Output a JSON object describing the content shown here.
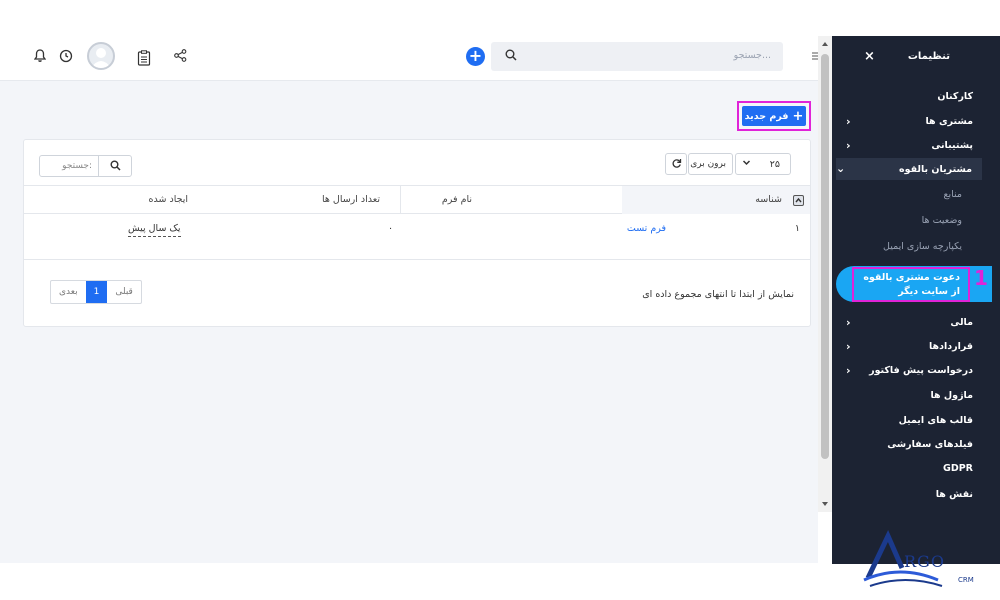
{
  "header": {
    "search_placeholder": "جستجو..."
  },
  "sidebar": {
    "title": "تنظیمات",
    "close": "×",
    "items": [
      {
        "label": "کارکنان"
      },
      {
        "label": "مشتری ها"
      },
      {
        "label": "پشتیبانی"
      },
      {
        "label": "مشتریان بالقوه"
      },
      {
        "label": "منابع"
      },
      {
        "label": "وضعیت ها"
      },
      {
        "label": "یکپارچه سازی ایمیل"
      },
      {
        "label": "دعوت مشتری بالقوه از سایت دیگر"
      },
      {
        "label": "مالی"
      },
      {
        "label": "قراردادها"
      },
      {
        "label": "درخواست پیش فاکتور"
      },
      {
        "label": "ماژول ها"
      },
      {
        "label": "قالب های ایمیل"
      },
      {
        "label": "فیلدهای سفارشی"
      },
      {
        "label": "GDPR"
      },
      {
        "label": "نقش ها"
      }
    ],
    "callout_number": "1"
  },
  "toolbar": {
    "new_form_label": "فرم جدید"
  },
  "table_controls": {
    "page_size": "۲۵",
    "export_label": "برون بری",
    "search_placeholder": "جستجو:"
  },
  "table": {
    "columns": [
      "شناسه",
      "نام فرم",
      "تعداد ارسال ها",
      "ایجاد شده"
    ],
    "rows": [
      {
        "id": "۱",
        "name": "فرم تست",
        "submissions": "۰",
        "created": "یک سال پیش"
      }
    ]
  },
  "footer": {
    "info": "نمایش از ابتدا تا انتهای مجموع داده ای",
    "prev": "قبلی",
    "page": "1",
    "next": "بعدی"
  },
  "logo": {
    "text": "RGO",
    "sub": "CRM"
  },
  "colors": {
    "accent": "#1f6df2",
    "sidebar_bg": "#1c2333",
    "highlight": "#1aa6f3",
    "annotation": "#e023d8"
  }
}
